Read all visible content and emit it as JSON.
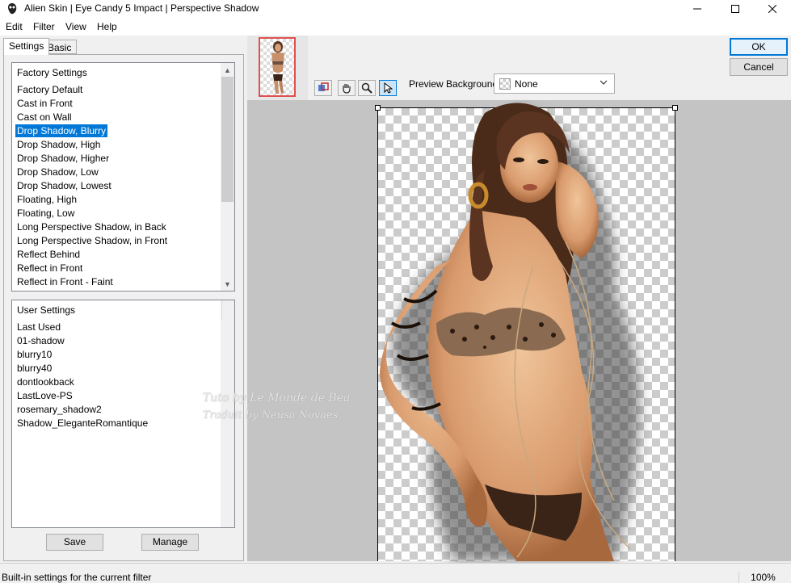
{
  "window": {
    "title": "Alien Skin | Eye Candy 5 Impact | Perspective Shadow",
    "minimize_icon": "minimize-icon",
    "maximize_icon": "maximize-icon",
    "close_icon": "close-icon"
  },
  "menu": [
    "Edit",
    "Filter",
    "View",
    "Help"
  ],
  "tabs": {
    "settings": "Settings",
    "basic": "Basic"
  },
  "factory_settings": {
    "header": "Factory Settings",
    "items": [
      "Factory Default",
      "Cast in Front",
      "Cast on Wall",
      "Drop Shadow, Blurry",
      "Drop Shadow, High",
      "Drop Shadow, Higher",
      "Drop Shadow, Low",
      "Drop Shadow, Lowest",
      "Floating, High",
      "Floating, Low",
      "Long Perspective Shadow, in Back",
      "Long Perspective Shadow, in Front",
      "Reflect Behind",
      "Reflect in Front",
      "Reflect in Front - Faint"
    ],
    "selected": "Drop Shadow, Blurry"
  },
  "user_settings": {
    "header": "User Settings",
    "items": [
      "Last Used",
      "01-shadow",
      "blurry10",
      "blurry40",
      "dontlookback",
      "LastLove-PS",
      "rosemary_shadow2",
      "Shadow_EleganteRomantique"
    ]
  },
  "buttons": {
    "save": "Save",
    "manage": "Manage",
    "ok": "OK",
    "cancel": "Cancel"
  },
  "toolbar": {
    "tools": [
      "view-compare-icon",
      "hand-pan-icon",
      "zoom-icon",
      "pointer-arrow-icon"
    ],
    "preview_background_label": "Preview Background:",
    "preview_background_value": "None"
  },
  "watermark": {
    "line1": "Tuto by Le Monde de Bea",
    "line2": "Traduit by Neusa Novaes"
  },
  "status": {
    "text": "Built-in settings for the current filter",
    "zoom": "100%"
  },
  "colors": {
    "selection": "#0078d7",
    "accent": "#0078d7",
    "thumb_border": "#e05050"
  }
}
